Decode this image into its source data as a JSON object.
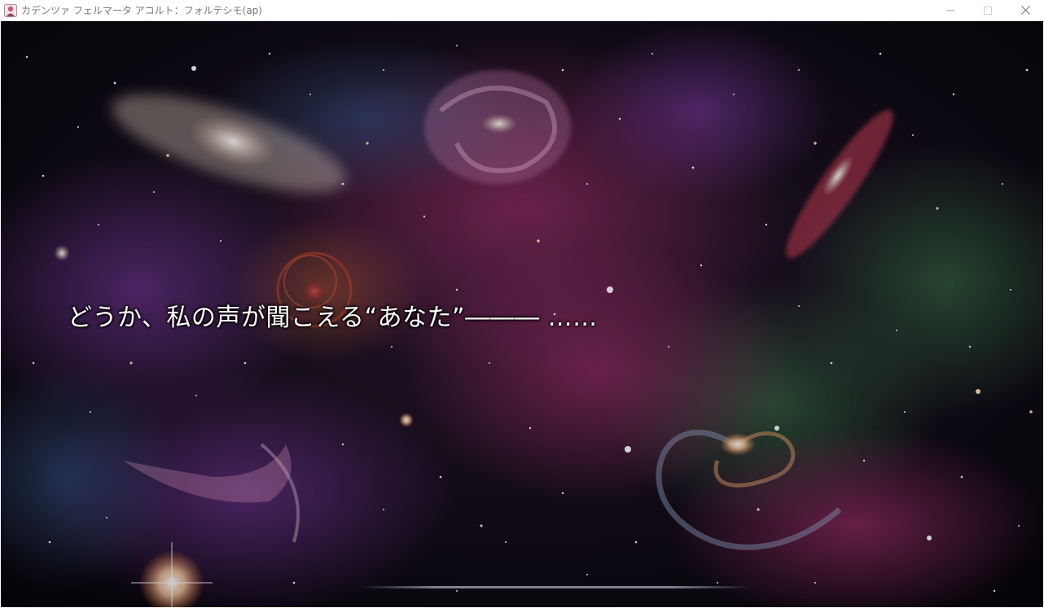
{
  "window": {
    "title": "カデンツァ フェルマータ アコルト：フォルテシモ(ap)",
    "icons": {
      "app": "app-icon",
      "minimize": "minimize-icon",
      "maximize": "maximize-icon",
      "close": "close-icon"
    }
  },
  "game": {
    "message": "どうか、私の声が聞こえる“あなた”――― ……"
  },
  "colors": {
    "titlebar_bg": "#ffffff",
    "title_text": "#777777",
    "message_text": "#ffffff"
  }
}
